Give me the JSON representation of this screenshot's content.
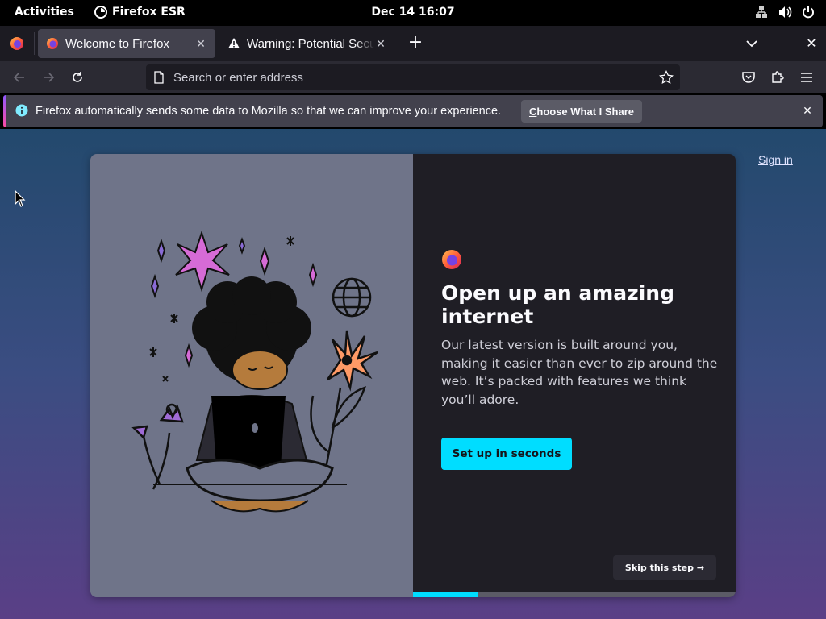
{
  "topbar": {
    "activities": "Activities",
    "app_name": "Firefox ESR",
    "clock": "Dec 14  16:07"
  },
  "tabs": [
    {
      "title": "Welcome to Firefox",
      "active": true
    },
    {
      "title": "Warning: Potential Security Risk Ahead",
      "active": false
    }
  ],
  "toolbar": {
    "url_placeholder": "Search or enter address"
  },
  "notification": {
    "message": "Firefox automatically sends some data to Mozilla so that we can improve your experience.",
    "button": "Choose What I Share"
  },
  "page": {
    "sign_in": "Sign in",
    "heading": "Open up an amazing internet",
    "body": "Our latest version is built around you, making it easier than ever to zip around the web. It’s packed with features we think you’ll adore.",
    "primary_button": "Set up in seconds",
    "skip_button": "Skip this step →",
    "progress": 0.2
  },
  "colors": {
    "accent": "#00ddff",
    "tab_active": "#42414d",
    "chrome": "#1c1b22"
  }
}
